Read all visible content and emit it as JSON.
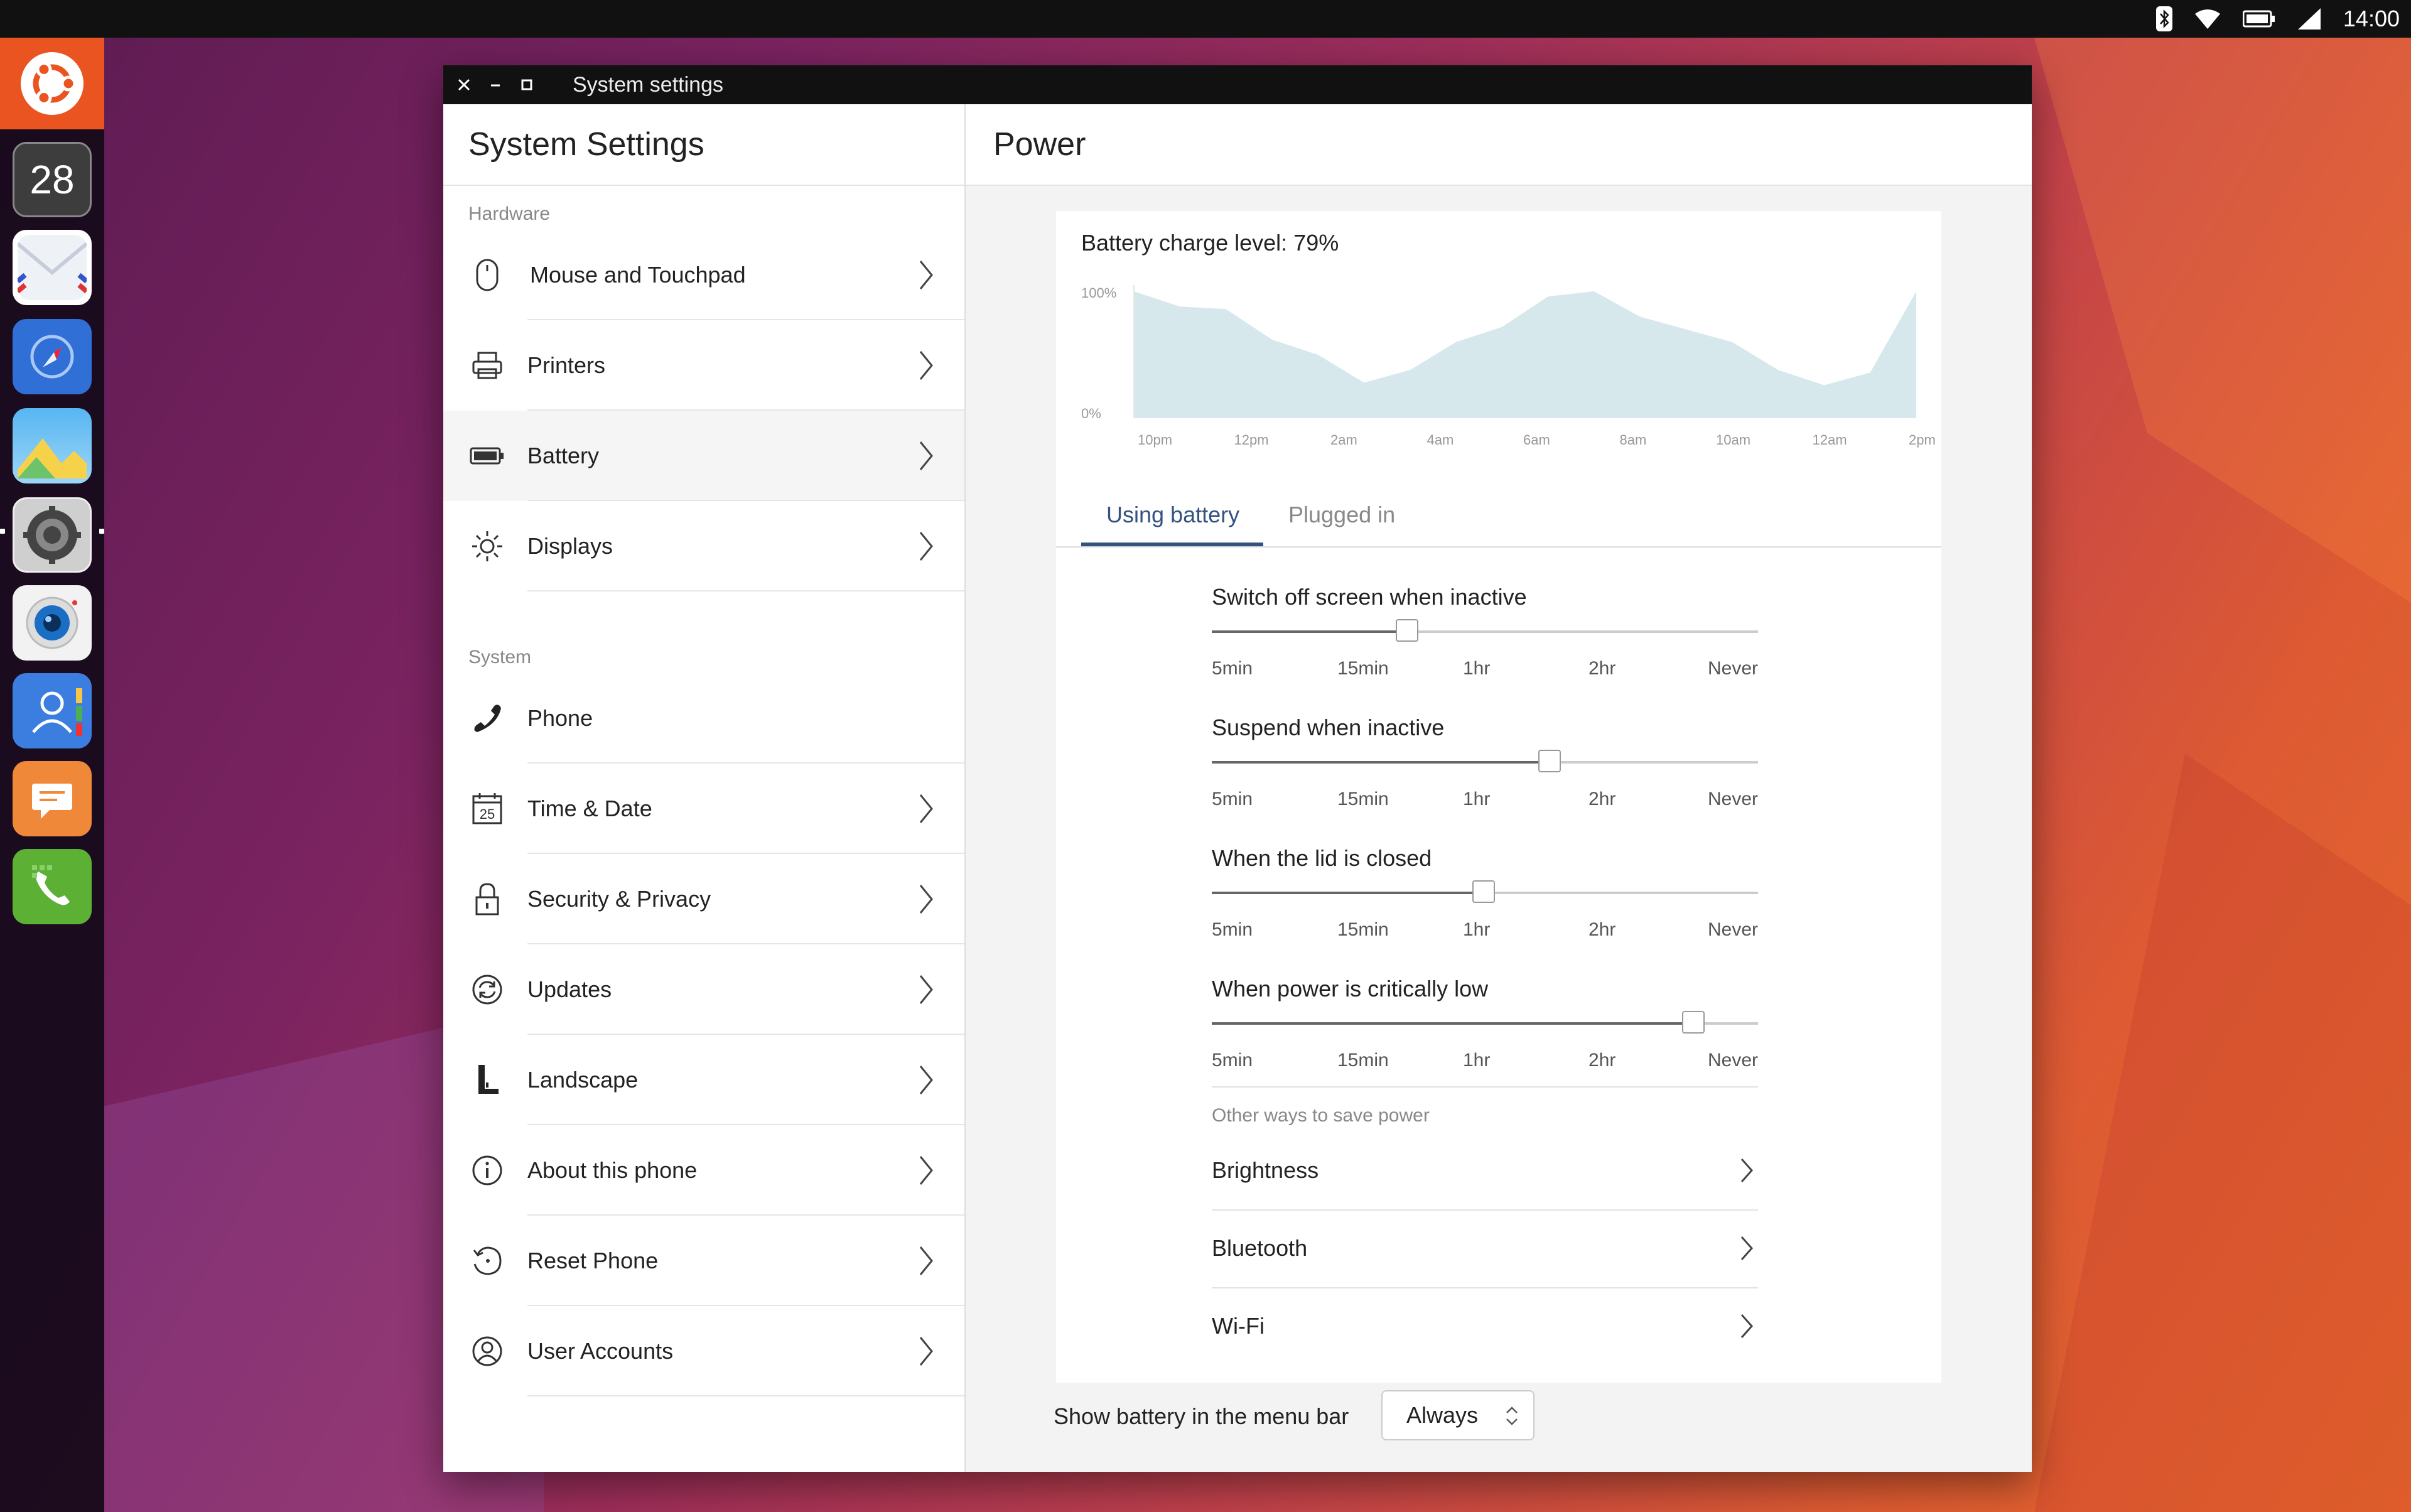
{
  "top_panel": {
    "clock": "14:00",
    "indicators": [
      "bluetooth-icon",
      "wifi-icon",
      "battery-icon",
      "signal-icon"
    ]
  },
  "launcher": {
    "items": [
      {
        "name": "ubuntu-logo-icon"
      },
      {
        "name": "calendar-app-icon",
        "label": "28"
      },
      {
        "name": "mail-app-icon"
      },
      {
        "name": "browser-app-icon"
      },
      {
        "name": "gallery-app-icon"
      },
      {
        "name": "settings-app-icon"
      },
      {
        "name": "camera-app-icon"
      },
      {
        "name": "contacts-app-icon"
      },
      {
        "name": "messaging-app-icon"
      },
      {
        "name": "phone-app-icon"
      }
    ]
  },
  "window": {
    "title": "System settings"
  },
  "left_pane": {
    "title": "System Settings",
    "sections": [
      {
        "label": "Hardware",
        "items": [
          {
            "label": "Mouse and Touchpad",
            "icon": "mouse-icon"
          },
          {
            "label": "Printers",
            "icon": "printer-icon"
          },
          {
            "label": "Battery",
            "icon": "battery-icon",
            "selected": true
          },
          {
            "label": "Displays",
            "icon": "brightness-icon"
          }
        ]
      },
      {
        "label": "System",
        "items": [
          {
            "label": "Phone",
            "icon": "phone-icon"
          },
          {
            "label": "Time & Date",
            "icon": "calendar-icon",
            "icon_text": "25"
          },
          {
            "label": "Security & Privacy",
            "icon": "lock-icon"
          },
          {
            "label": "Updates",
            "icon": "sync-icon"
          },
          {
            "label": "Landscape",
            "icon": "landscape-icon"
          },
          {
            "label": "About this phone",
            "icon": "info-icon"
          },
          {
            "label": "Reset Phone",
            "icon": "reset-icon"
          },
          {
            "label": "User Accounts",
            "icon": "user-icon"
          }
        ]
      }
    ]
  },
  "right_pane": {
    "title": "Power",
    "battery": {
      "charge_label": "Battery charge level: 79%"
    },
    "tabs": [
      {
        "label": "Using battery",
        "active": true
      },
      {
        "label": "Plugged in",
        "active": false
      }
    ],
    "sliders": [
      {
        "title": "Switch off screen when inactive",
        "value_fraction": 0.357
      },
      {
        "title": "Suspend when inactive",
        "value_fraction": 0.618
      },
      {
        "title": "When the lid is closed",
        "value_fraction": 0.498
      },
      {
        "title": "When power is critically low",
        "value_fraction": 0.882
      }
    ],
    "slider_ticks": [
      "5min",
      "15min",
      "1hr",
      "2hr",
      "Never"
    ],
    "other_ways": {
      "label": "Other ways to save power",
      "items": [
        "Brightness",
        "Bluetooth",
        "Wi-Fi"
      ]
    },
    "menu_bar": {
      "label": "Show battery in the menu bar",
      "value": "Always"
    }
  },
  "chart_data": {
    "type": "area",
    "title": "Battery charge level: 79%",
    "xlabel": "",
    "ylabel": "",
    "x": [
      "10pm",
      "11pm",
      "12pm",
      "1am",
      "2am",
      "3am",
      "4am",
      "5am",
      "6am",
      "7am",
      "8am",
      "9am",
      "10am",
      "11am",
      "12am",
      "1pm",
      "2pm",
      "3pm"
    ],
    "values": [
      100,
      88,
      86,
      62,
      50,
      28,
      38,
      60,
      72,
      96,
      100,
      80,
      70,
      60,
      38,
      26,
      36,
      100
    ],
    "tick_labels": [
      "10pm",
      "12pm",
      "2am",
      "4am",
      "6am",
      "8am",
      "10am",
      "12am",
      "2pm"
    ],
    "y_tick_labels": [
      "100%",
      "0%"
    ],
    "ylim": [
      0,
      100
    ],
    "grid": false,
    "fill_color": "#d6e8eb"
  }
}
